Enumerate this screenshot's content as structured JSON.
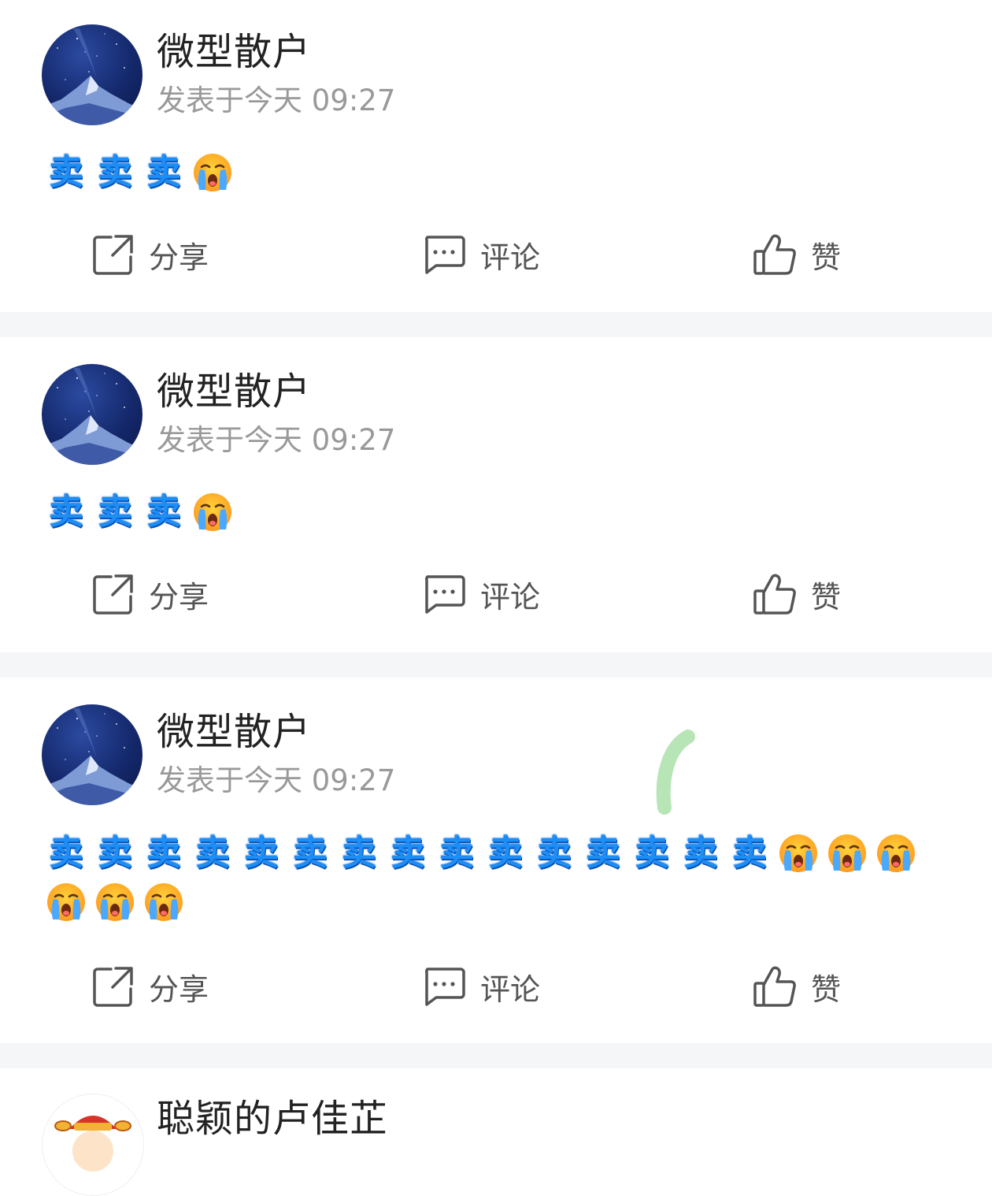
{
  "posts": [
    {
      "author": "微型散户",
      "meta": "发表于今天 09:27",
      "content": {
        "sell_text": "卖",
        "sell_count": 3,
        "cry_count": 1
      },
      "actions": {
        "share": "分享",
        "comment": "评论",
        "like": "赞"
      }
    },
    {
      "author": "微型散户",
      "meta": "发表于今天 09:27",
      "content": {
        "sell_text": "卖",
        "sell_count": 3,
        "cry_count": 1
      },
      "actions": {
        "share": "分享",
        "comment": "评论",
        "like": "赞"
      }
    },
    {
      "author": "微型散户",
      "meta": "发表于今天 09:27",
      "content": {
        "sell_text": "卖",
        "sell_count": 15,
        "cry_count": 6
      },
      "actions": {
        "share": "分享",
        "comment": "评论",
        "like": "赞"
      }
    },
    {
      "author": "聪颖的卢佳芷"
    }
  ],
  "colors": {
    "sell_blue": "#1d8ef5",
    "separator": "#f5f6f8",
    "meta_gray": "#999999",
    "action_gray": "#555555"
  },
  "icons": {
    "share": "share-icon",
    "comment": "comment-icon",
    "like": "thumbs-up-icon",
    "cry": "loudly-crying-face-emoji"
  }
}
